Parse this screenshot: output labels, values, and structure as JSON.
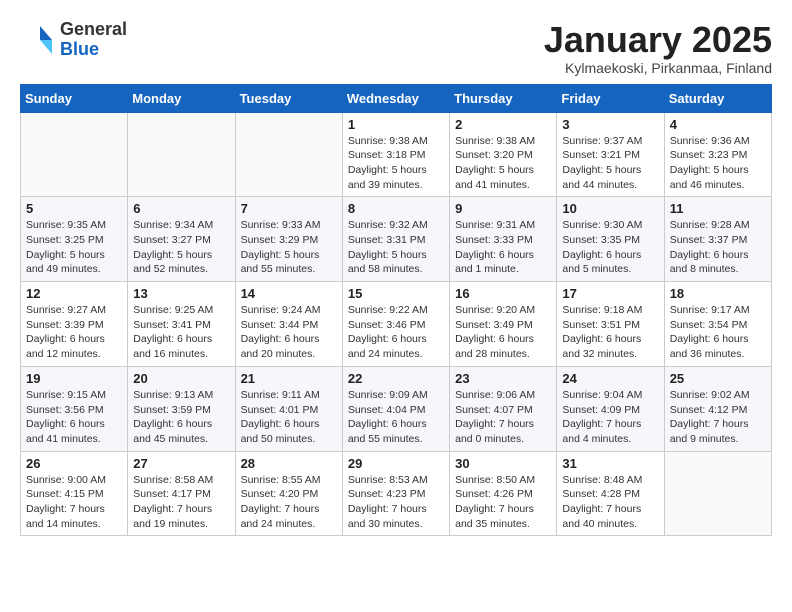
{
  "header": {
    "logo_general": "General",
    "logo_blue": "Blue",
    "month_title": "January 2025",
    "subtitle": "Kylmaekoski, Pirkanmaa, Finland"
  },
  "weekdays": [
    "Sunday",
    "Monday",
    "Tuesday",
    "Wednesday",
    "Thursday",
    "Friday",
    "Saturday"
  ],
  "weeks": [
    [
      {
        "day": "",
        "info": ""
      },
      {
        "day": "",
        "info": ""
      },
      {
        "day": "",
        "info": ""
      },
      {
        "day": "1",
        "info": "Sunrise: 9:38 AM\nSunset: 3:18 PM\nDaylight: 5 hours\nand 39 minutes."
      },
      {
        "day": "2",
        "info": "Sunrise: 9:38 AM\nSunset: 3:20 PM\nDaylight: 5 hours\nand 41 minutes."
      },
      {
        "day": "3",
        "info": "Sunrise: 9:37 AM\nSunset: 3:21 PM\nDaylight: 5 hours\nand 44 minutes."
      },
      {
        "day": "4",
        "info": "Sunrise: 9:36 AM\nSunset: 3:23 PM\nDaylight: 5 hours\nand 46 minutes."
      }
    ],
    [
      {
        "day": "5",
        "info": "Sunrise: 9:35 AM\nSunset: 3:25 PM\nDaylight: 5 hours\nand 49 minutes."
      },
      {
        "day": "6",
        "info": "Sunrise: 9:34 AM\nSunset: 3:27 PM\nDaylight: 5 hours\nand 52 minutes."
      },
      {
        "day": "7",
        "info": "Sunrise: 9:33 AM\nSunset: 3:29 PM\nDaylight: 5 hours\nand 55 minutes."
      },
      {
        "day": "8",
        "info": "Sunrise: 9:32 AM\nSunset: 3:31 PM\nDaylight: 5 hours\nand 58 minutes."
      },
      {
        "day": "9",
        "info": "Sunrise: 9:31 AM\nSunset: 3:33 PM\nDaylight: 6 hours\nand 1 minute."
      },
      {
        "day": "10",
        "info": "Sunrise: 9:30 AM\nSunset: 3:35 PM\nDaylight: 6 hours\nand 5 minutes."
      },
      {
        "day": "11",
        "info": "Sunrise: 9:28 AM\nSunset: 3:37 PM\nDaylight: 6 hours\nand 8 minutes."
      }
    ],
    [
      {
        "day": "12",
        "info": "Sunrise: 9:27 AM\nSunset: 3:39 PM\nDaylight: 6 hours\nand 12 minutes."
      },
      {
        "day": "13",
        "info": "Sunrise: 9:25 AM\nSunset: 3:41 PM\nDaylight: 6 hours\nand 16 minutes."
      },
      {
        "day": "14",
        "info": "Sunrise: 9:24 AM\nSunset: 3:44 PM\nDaylight: 6 hours\nand 20 minutes."
      },
      {
        "day": "15",
        "info": "Sunrise: 9:22 AM\nSunset: 3:46 PM\nDaylight: 6 hours\nand 24 minutes."
      },
      {
        "day": "16",
        "info": "Sunrise: 9:20 AM\nSunset: 3:49 PM\nDaylight: 6 hours\nand 28 minutes."
      },
      {
        "day": "17",
        "info": "Sunrise: 9:18 AM\nSunset: 3:51 PM\nDaylight: 6 hours\nand 32 minutes."
      },
      {
        "day": "18",
        "info": "Sunrise: 9:17 AM\nSunset: 3:54 PM\nDaylight: 6 hours\nand 36 minutes."
      }
    ],
    [
      {
        "day": "19",
        "info": "Sunrise: 9:15 AM\nSunset: 3:56 PM\nDaylight: 6 hours\nand 41 minutes."
      },
      {
        "day": "20",
        "info": "Sunrise: 9:13 AM\nSunset: 3:59 PM\nDaylight: 6 hours\nand 45 minutes."
      },
      {
        "day": "21",
        "info": "Sunrise: 9:11 AM\nSunset: 4:01 PM\nDaylight: 6 hours\nand 50 minutes."
      },
      {
        "day": "22",
        "info": "Sunrise: 9:09 AM\nSunset: 4:04 PM\nDaylight: 6 hours\nand 55 minutes."
      },
      {
        "day": "23",
        "info": "Sunrise: 9:06 AM\nSunset: 4:07 PM\nDaylight: 7 hours\nand 0 minutes."
      },
      {
        "day": "24",
        "info": "Sunrise: 9:04 AM\nSunset: 4:09 PM\nDaylight: 7 hours\nand 4 minutes."
      },
      {
        "day": "25",
        "info": "Sunrise: 9:02 AM\nSunset: 4:12 PM\nDaylight: 7 hours\nand 9 minutes."
      }
    ],
    [
      {
        "day": "26",
        "info": "Sunrise: 9:00 AM\nSunset: 4:15 PM\nDaylight: 7 hours\nand 14 minutes."
      },
      {
        "day": "27",
        "info": "Sunrise: 8:58 AM\nSunset: 4:17 PM\nDaylight: 7 hours\nand 19 minutes."
      },
      {
        "day": "28",
        "info": "Sunrise: 8:55 AM\nSunset: 4:20 PM\nDaylight: 7 hours\nand 24 minutes."
      },
      {
        "day": "29",
        "info": "Sunrise: 8:53 AM\nSunset: 4:23 PM\nDaylight: 7 hours\nand 30 minutes."
      },
      {
        "day": "30",
        "info": "Sunrise: 8:50 AM\nSunset: 4:26 PM\nDaylight: 7 hours\nand 35 minutes."
      },
      {
        "day": "31",
        "info": "Sunrise: 8:48 AM\nSunset: 4:28 PM\nDaylight: 7 hours\nand 40 minutes."
      },
      {
        "day": "",
        "info": ""
      }
    ]
  ]
}
